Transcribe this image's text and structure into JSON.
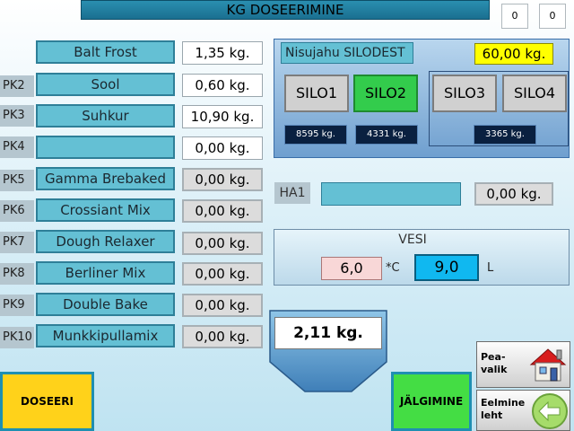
{
  "title": "KG DOSEERIMINE",
  "counters": [
    "0",
    "0"
  ],
  "rows": [
    {
      "pk": "",
      "name": "Balt Frost",
      "value": "1,35 kg.",
      "style": "white"
    },
    {
      "pk": "PK2",
      "name": "Sool",
      "value": "0,60 kg.",
      "style": "white"
    },
    {
      "pk": "PK3",
      "name": "Suhkur",
      "value": "10,90 kg.",
      "style": "white"
    },
    {
      "pk": "PK4",
      "name": "",
      "value": "0,00 kg.",
      "style": "white"
    },
    {
      "pk": "PK5",
      "name": "Gamma Brebaked",
      "value": "0,00 kg.",
      "style": "grey"
    },
    {
      "pk": "PK6",
      "name": "Crossiant Mix",
      "value": "0,00 kg.",
      "style": "grey"
    },
    {
      "pk": "PK7",
      "name": "Dough Relaxer",
      "value": "0,00 kg.",
      "style": "grey"
    },
    {
      "pk": "PK8",
      "name": "Berliner Mix",
      "value": "0,00 kg.",
      "style": "grey"
    },
    {
      "pk": "PK9",
      "name": "Double Bake",
      "value": "0,00 kg.",
      "style": "grey"
    },
    {
      "pk": "PK10",
      "name": "Munkkipullamix",
      "value": "0,00 kg.",
      "style": "grey"
    }
  ],
  "silo": {
    "title": "Nisujahu SILODEST",
    "target": "60,00 kg.",
    "buttons": [
      {
        "label": "SILO1",
        "active": false
      },
      {
        "label": "SILO2",
        "active": true
      },
      {
        "label": "SILO3",
        "active": false
      },
      {
        "label": "SILO4",
        "active": false
      }
    ],
    "kg_readings": [
      "8595 kg.",
      "4331 kg.",
      "3365 kg."
    ]
  },
  "ha": {
    "label": "HA1",
    "value": "0,00 kg."
  },
  "vesi": {
    "title": "VESI",
    "temp": "6,0",
    "temp_unit": "*C",
    "liters": "9,0",
    "liters_unit": "L"
  },
  "total": "2,11 kg.",
  "buttons": {
    "doseeri": "DOSEERI",
    "jalgimine": "JÄLGIMINE",
    "peavalik_line1": "Pea-",
    "peavalik_line2": "valik",
    "eelmine_line1": "Eelmine",
    "eelmine_line2": "leht"
  },
  "colors": {
    "accent": "#64c0d4",
    "active_silo": "#33cc4c",
    "target_yellow": "#ffff00",
    "water_blue": "#10b8f0"
  },
  "icons": [
    "house-icon",
    "back-arrow-icon"
  ]
}
